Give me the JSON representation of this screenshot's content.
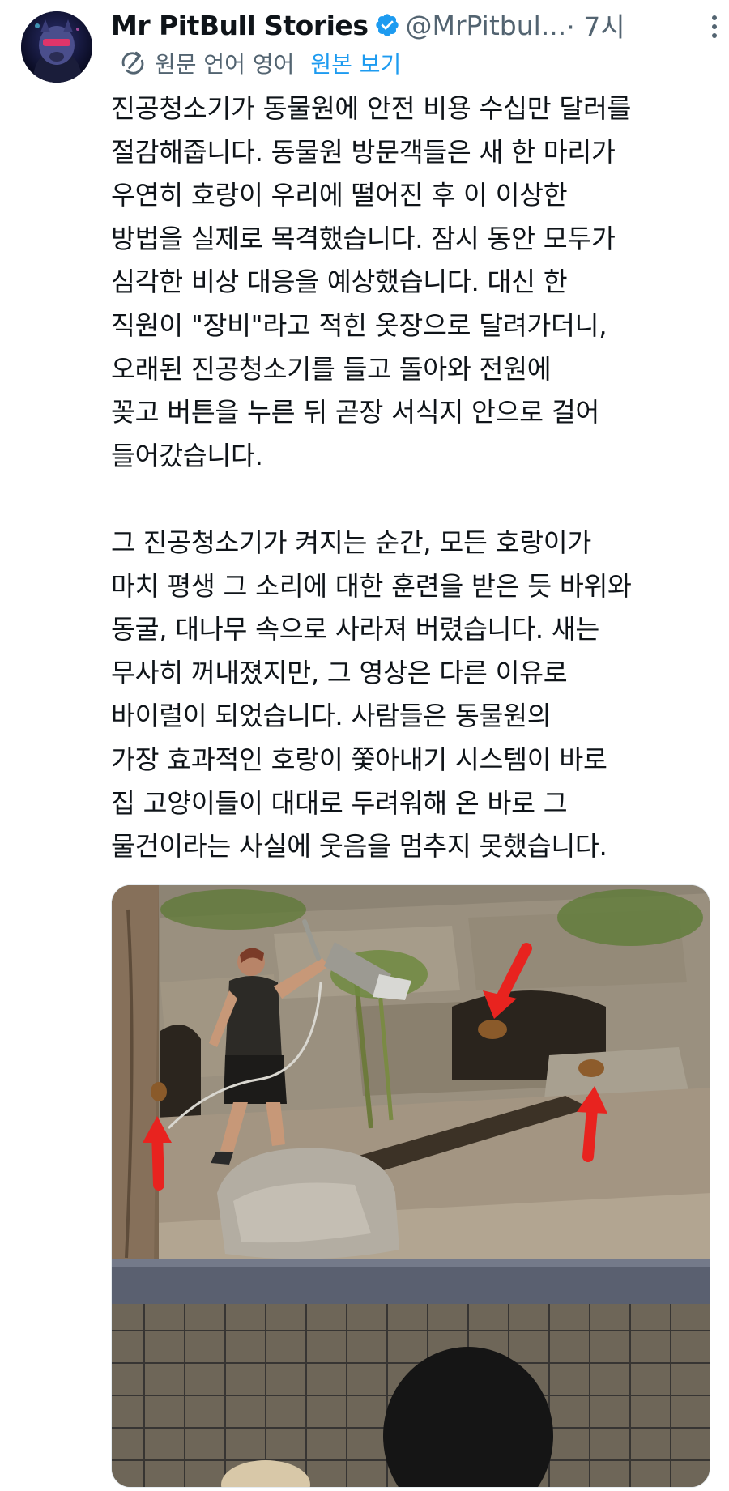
{
  "author": {
    "name": "Mr PitBull Stories",
    "handle": "@MrPitbul...",
    "time": "· 7시"
  },
  "translation": {
    "label": "원문 언어 영어",
    "show_original": "원본 보기"
  },
  "text_lines": [
    "진공청소기가 동물원에 안전 비용 수십만 달러를",
    "절감해줍니다. 동물원 방문객들은 새 한 마리가",
    "우연히 호랑이 우리에 떨어진 후 이 이상한",
    "방법을 실제로 목격했습니다. 잠시 동안 모두가",
    "심각한 비상 대응을 예상했습니다. 대신 한",
    "직원이 \"장비\"라고 적힌 옷장으로 달려가더니,",
    "오래된 진공청소기를 들고 돌아와 전원에",
    "꽂고 버튼을 누른 뒤 곧장 서식지 안으로 걸어",
    "들어갔습니다.",
    "",
    "그 진공청소기가 켜지는 순간, 모든 호랑이가",
    "마치 평생 그 소리에 대한 훈련을 받은 듯 바위와",
    "동굴, 대나무 속으로 사라져 버렸습니다. 새는",
    "무사히 꺼내졌지만, 그 영상은 다른 이유로",
    "바이럴이 되었습니다. 사람들은 동물원의",
    "가장 효과적인 호랑이 쫓아내기 시스템이 바로",
    "집 고양이들이 대대로 두려워해 온 바로 그",
    "물건이라는 사실에 웃음을 멈추지 못했습니다."
  ],
  "colors": {
    "accent": "#1d9bf0",
    "secondary_text": "#536471",
    "primary_text": "#0f1419",
    "arrow_red": "#e8231f"
  },
  "icons": {
    "verified": "verified-badge-icon",
    "more": "more-options-icon",
    "translate": "translate-icon"
  }
}
